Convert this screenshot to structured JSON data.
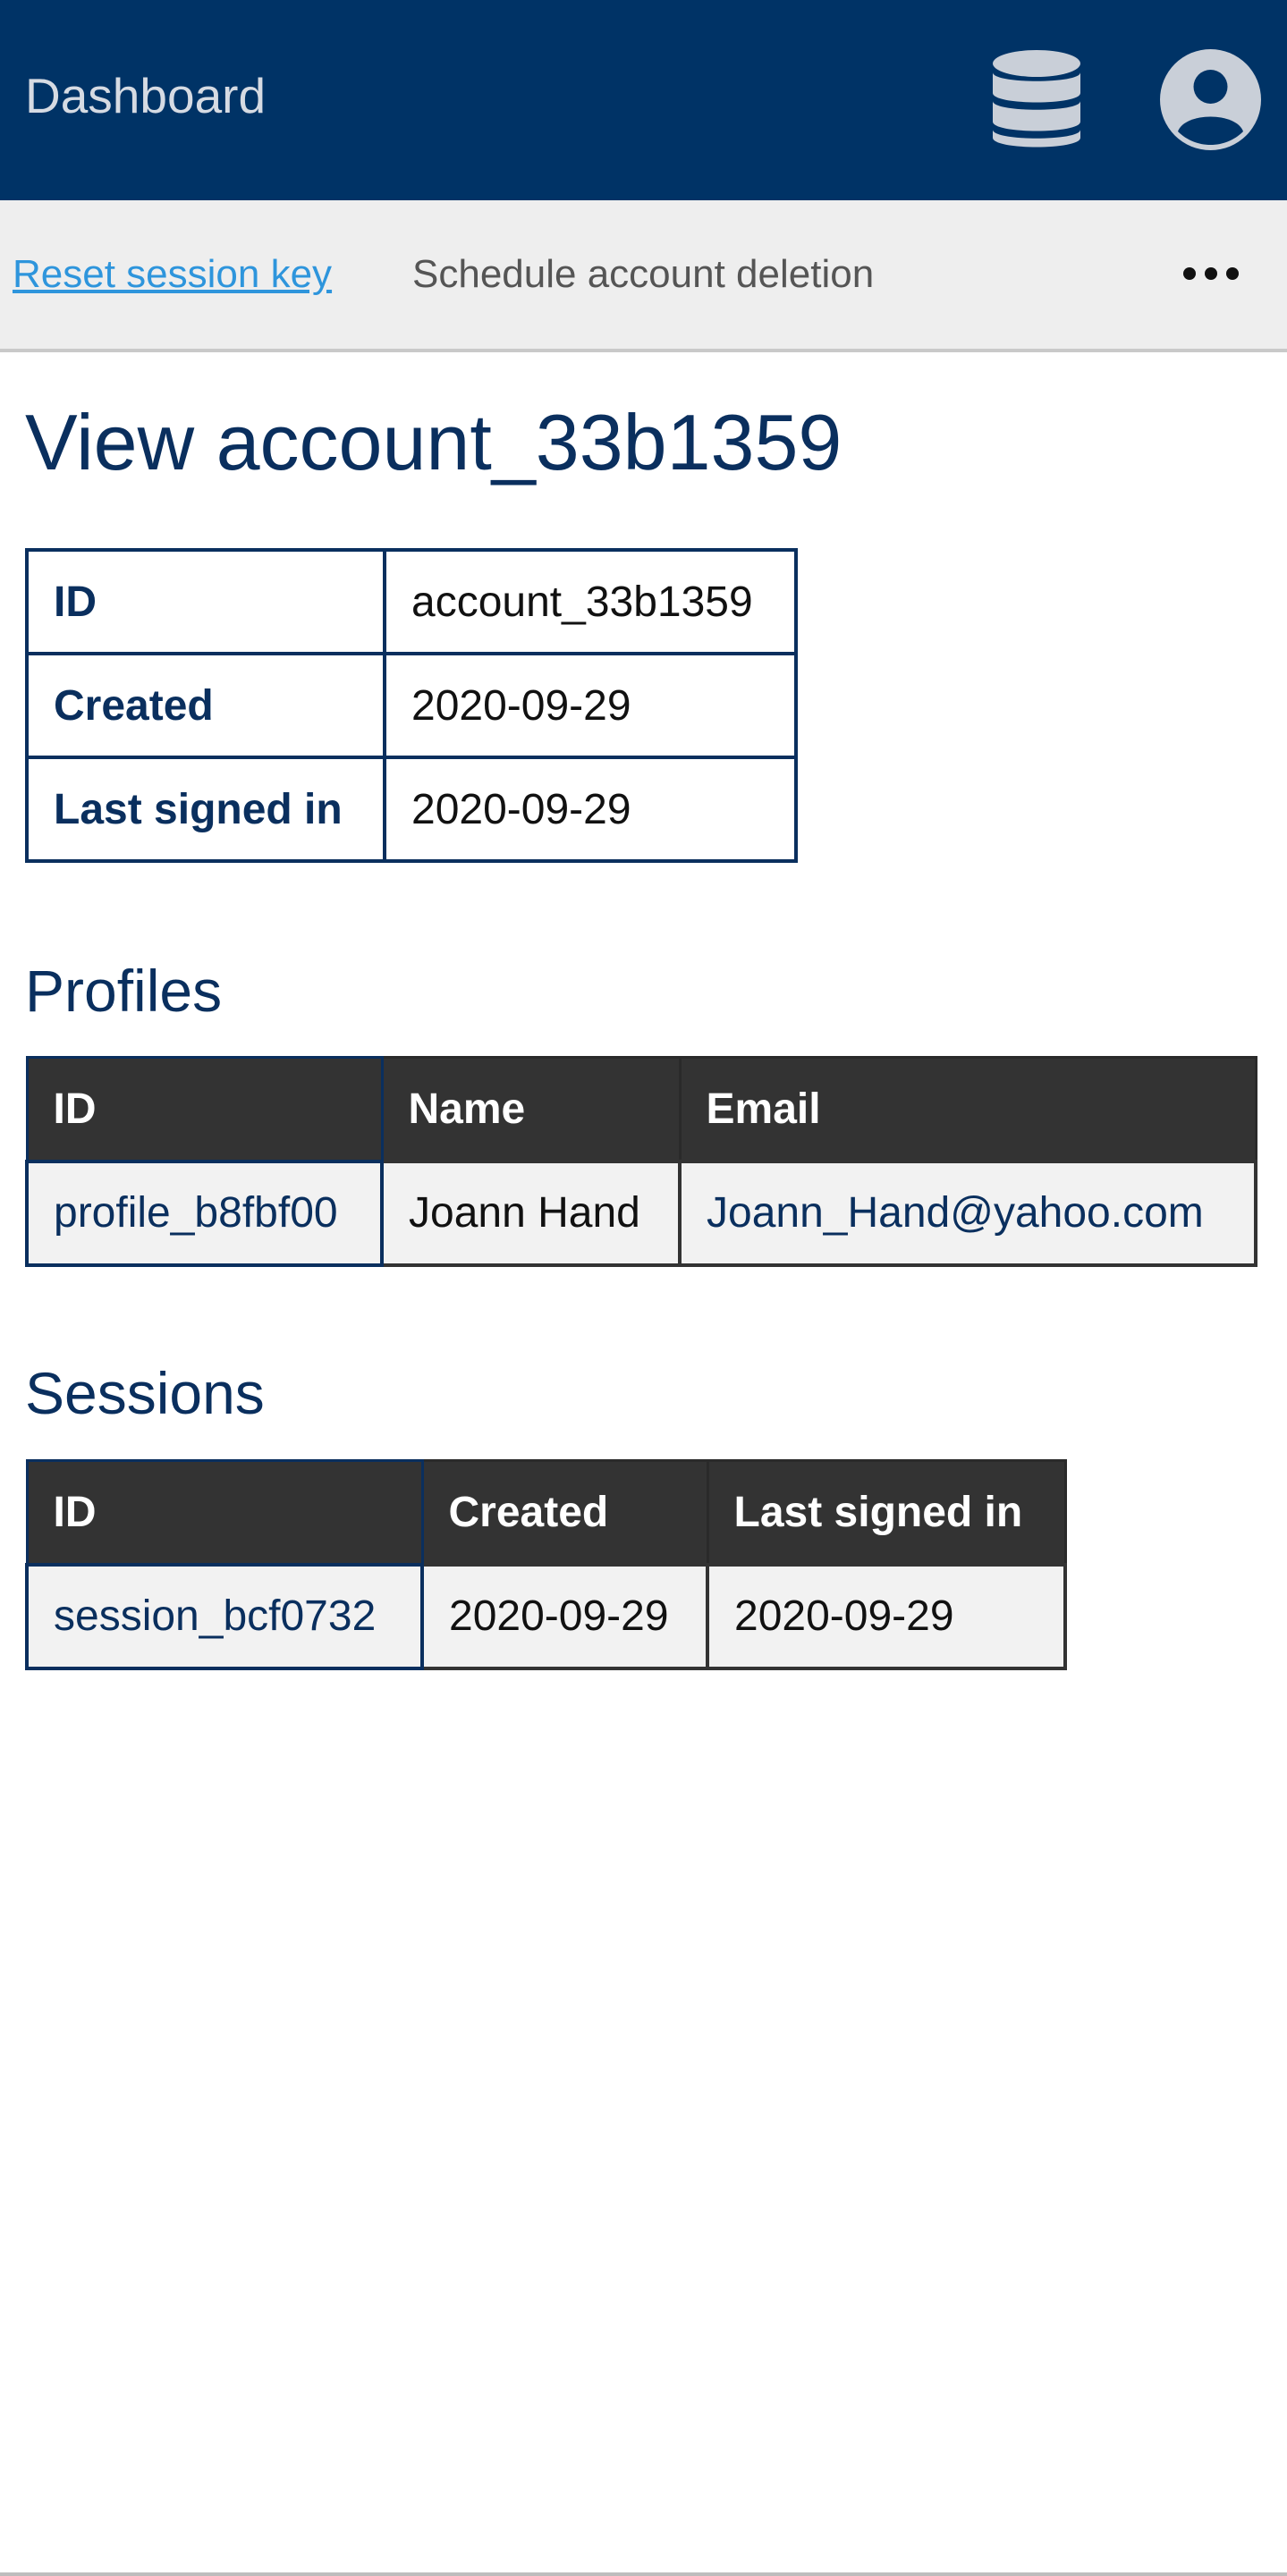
{
  "header": {
    "brand": "Dashboard",
    "database_icon": "database-icon",
    "user_icon": "user-circle-icon",
    "background_color": "#003366"
  },
  "actions": {
    "reset_session_key": "Reset session key",
    "schedule_account_deletion": "Schedule account deletion",
    "more_icon": "ellipsis-icon"
  },
  "page": {
    "title": "View account_33b1359"
  },
  "account_details": [
    {
      "label": "ID",
      "value": "account_33b1359"
    },
    {
      "label": "Created",
      "value": "2020-09-29"
    },
    {
      "label": "Last signed in",
      "value": "2020-09-29"
    }
  ],
  "profiles": {
    "title": "Profiles",
    "columns": [
      "ID",
      "Name",
      "Email"
    ],
    "rows": [
      {
        "id": "profile_b8fbf00",
        "name": "Joann Hand",
        "email": "Joann_Hand@yahoo.com"
      }
    ]
  },
  "sessions": {
    "title": "Sessions",
    "columns": [
      "ID",
      "Created",
      "Last signed in"
    ],
    "rows": [
      {
        "id": "session_bcf0732",
        "created": "2020-09-29",
        "last_signed_in": "2020-09-29"
      }
    ]
  },
  "colors": {
    "accent": "#0a2f5e",
    "link": "#2e95dc",
    "table_header": "#333333"
  }
}
